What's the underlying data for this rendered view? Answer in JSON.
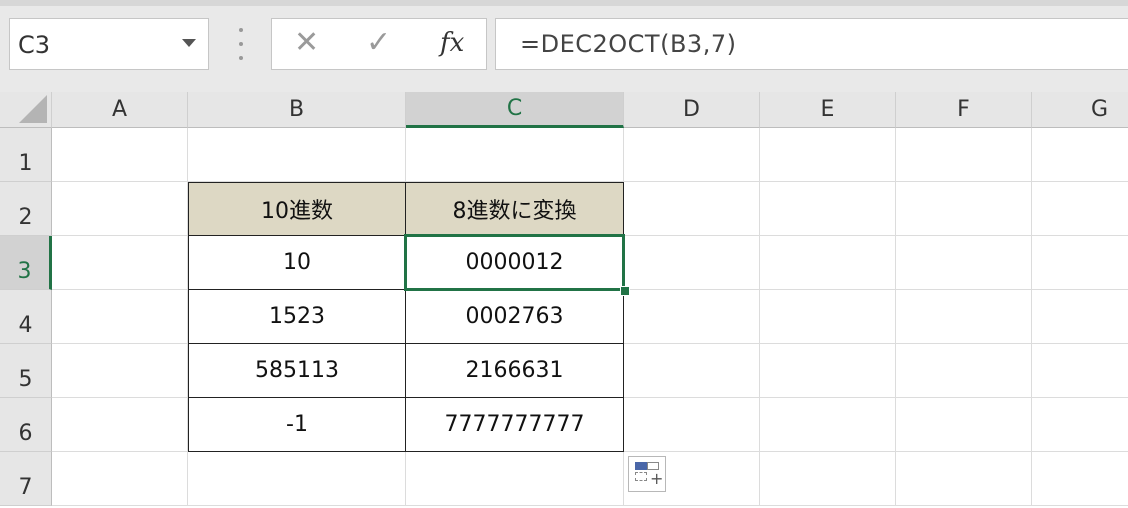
{
  "name_box": {
    "value": "C3"
  },
  "formula_bar": {
    "cancel": "✕",
    "enter": "✓",
    "fx": "fx",
    "formula": "=DEC2OCT(B3,7)"
  },
  "columns": [
    "A",
    "B",
    "C",
    "D",
    "E",
    "F",
    "G"
  ],
  "rows": [
    "1",
    "2",
    "3",
    "4",
    "5",
    "6",
    "7"
  ],
  "selected_cell": {
    "column": "C",
    "row": "3"
  },
  "table": {
    "headers": [
      "10進数",
      "8進数に変換"
    ],
    "rows": [
      [
        "10",
        "0000012"
      ],
      [
        "1523",
        "0002763"
      ],
      [
        "585113",
        "2166631"
      ],
      [
        "-1",
        "7777777777"
      ]
    ]
  },
  "colors": {
    "accent": "#217346",
    "header_fill": "#ddd8c4"
  },
  "icons": {
    "quick_analysis": "quick-analysis-icon"
  }
}
